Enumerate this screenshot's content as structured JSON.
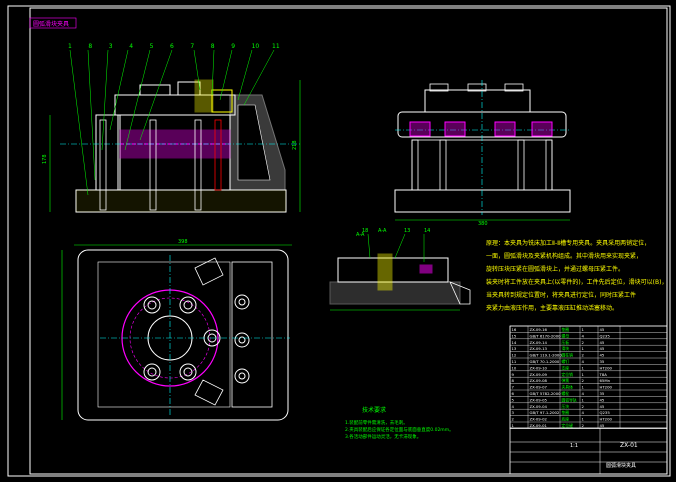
{
  "drawing": {
    "corner_label": "圆弧滑块夹具",
    "balloons": [
      "1",
      "8",
      "3",
      "4",
      "5",
      "6",
      "7",
      "8",
      "9",
      "10",
      "11"
    ],
    "balloons_lower": [
      "18",
      "A-A",
      "13",
      "14"
    ],
    "dim_width": "398",
    "dim_height": "218",
    "dim_height2": "178",
    "dim_side": "380",
    "dim_right": "380",
    "section_label": "A-A",
    "notes_title": "技术要求",
    "notes_lines": [
      "1.装配前零件需清洗，去毛刺。",
      "2.夹具装配后应保证各定位面与底面垂直度0.02mm。",
      "3.各活动部件运动灵活，无卡滞现象。"
    ],
    "principle_lines": [
      "原理：本夹具为铣床加工Ⅱ-Ⅱ槽专用夹具。夹具采用两销定位，",
      "一面，圆弧滑块及夹紧机构组成。其中滑块用来实现夹紧，",
      "旋转压块压紧在圆弧滑块上，并通过螺母压紧工件。",
      "装夹时将工件放在夹具上(以零件的)，工件先后定位，滑块可以(B)，",
      "当夹具转到规定位置时，将夹具进行定位，同时压紧工件",
      "夹紧力由液压作用，主要靠液压缸推动活塞移动。"
    ],
    "title_block": {
      "drawing_no": "ZX-01",
      "name": "圆弧滑块夹具",
      "scale": "1:1"
    },
    "bom_rows": [
      [
        "16",
        "ZX-09-16",
        "垫圈",
        "1",
        "45",
        ""
      ],
      [
        "15",
        "GB/T 6170-2000",
        "螺母",
        "4",
        "Q235",
        ""
      ],
      [
        "14",
        "ZX-09-14",
        "压板",
        "2",
        "45",
        ""
      ],
      [
        "13",
        "ZX-09-13",
        "滑块",
        "1",
        "45",
        ""
      ],
      [
        "12",
        "GB/T 119.1-2000",
        "圆柱销",
        "2",
        "45",
        ""
      ],
      [
        "11",
        "GB/T 70.1-2000",
        "螺钉",
        "4",
        "35",
        ""
      ],
      [
        "10",
        "ZX-09-10",
        "支座",
        "1",
        "HT200",
        ""
      ],
      [
        "9",
        "ZX-09-09",
        "定位销",
        "1",
        "T8A",
        ""
      ],
      [
        "8",
        "ZX-09-08",
        "弹簧",
        "2",
        "65Mn",
        ""
      ],
      [
        "7",
        "ZX-09-07",
        "夹具体",
        "1",
        "HT200",
        ""
      ],
      [
        "6",
        "GB/T 5782-2000",
        "螺栓",
        "4",
        "35",
        ""
      ],
      [
        "5",
        "ZX-09-05",
        "圆弧导轨",
        "1",
        "45",
        ""
      ],
      [
        "4",
        "ZX-09-04",
        "压块",
        "2",
        "45",
        ""
      ],
      [
        "3",
        "GB/T 97.1-2002",
        "垫圈",
        "4",
        "Q235",
        ""
      ],
      [
        "2",
        "ZX-09-02",
        "底座",
        "1",
        "HT200",
        ""
      ],
      [
        "1",
        "ZX-09-01",
        "定位键",
        "2",
        "45",
        ""
      ]
    ]
  },
  "colors": {
    "frame": "#ffffff",
    "cyan": "#00ffff",
    "yellow": "#ffff00",
    "magenta": "#ff00ff",
    "green": "#00ff00",
    "gray": "#808080",
    "red": "#ff0000"
  }
}
